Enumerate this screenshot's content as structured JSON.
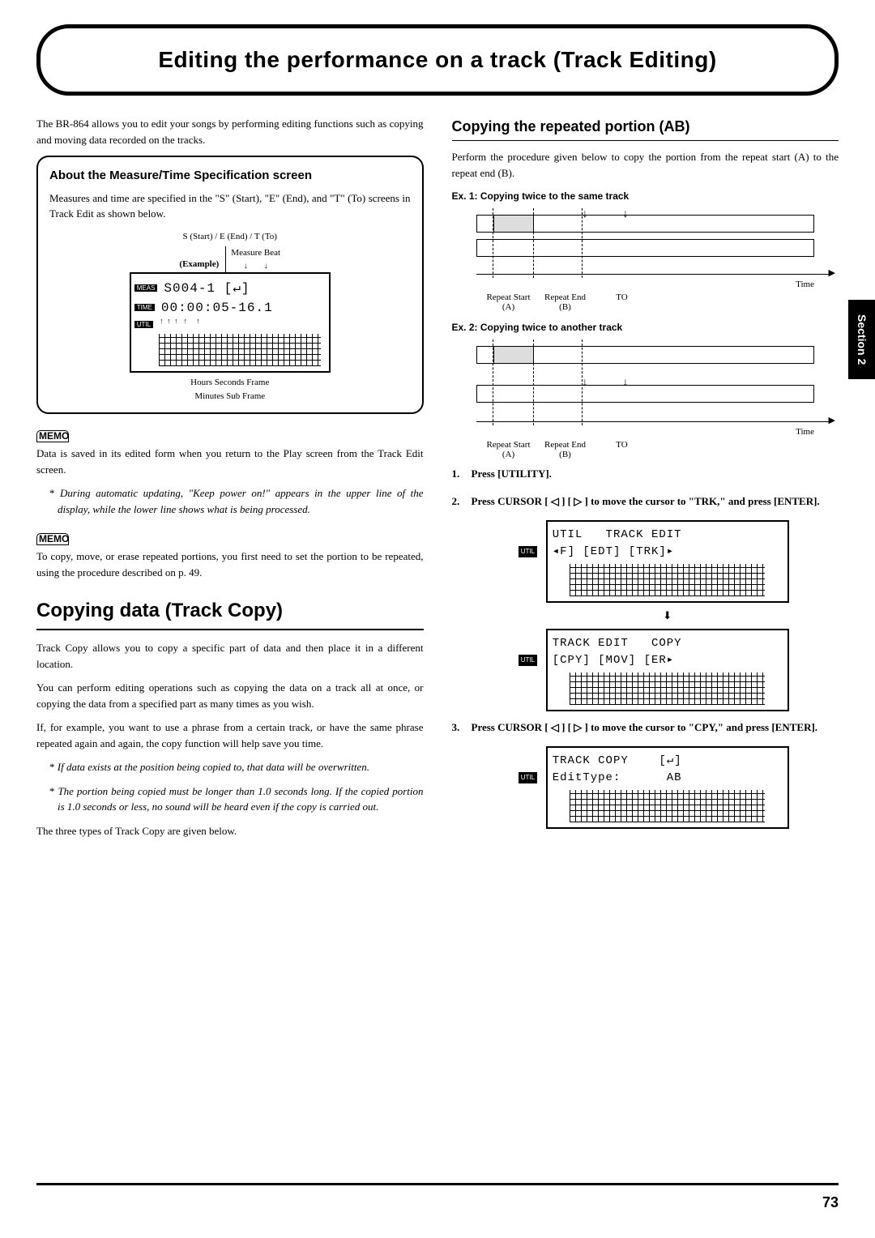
{
  "title": "Editing the performance on a track (Track Editing)",
  "section_tab": "Section 2",
  "page_number": "73",
  "intro": "The BR-864 allows you to edit your songs by performing editing functions such as copying and moving data recorded on the tracks.",
  "about_box": {
    "heading": "About the Measure/Time Specification screen",
    "body": "Measures and time are specified in the \"S\" (Start), \"E\" (End), and \"T\" (To) screens in Track Edit as shown below.",
    "top_label": "S (Start) / E (End)  / T (To)",
    "example_label": "(Example)",
    "col_labels": "Measure   Beat",
    "meas_tag": "MEAS",
    "time_tag": "TIME",
    "util_tag": "UTIL",
    "lcd_line1": "S004-1        [↵]",
    "lcd_line2": "00:00:05-16.1",
    "bottom_labels_1": "Hours       Seconds  Frame",
    "bottom_labels_2": "Minutes                       Sub Frame"
  },
  "memo1_body": "Data is saved in its edited form when you return to the Play screen from the Track Edit screen.",
  "memo1_note": "During automatic updating, \"Keep power on!\" appears in the upper line of the display, while the lower line shows what is being processed.",
  "memo2_body": "To copy, move, or erase repeated portions, you first need to set the portion to be repeated, using the procedure described on p. 49.",
  "h2_copy": "Copying data (Track Copy)",
  "copy_p1": "Track Copy allows you to copy a specific part of data and then place it in a different location.",
  "copy_p2": "You can perform editing operations such as copying the data on a track all at once, or copying the data from a specified part as many times as you wish.",
  "copy_p3": "If, for example, you want to use a phrase from a certain track, or have the same phrase repeated again and again, the copy function will help save you time.",
  "copy_note1": "If data exists at the position being copied to, that data will be overwritten.",
  "copy_note2": "The portion being copied must be longer than 1.0 seconds long. If the copied portion is 1.0 seconds or less, no sound will be heard even if the copy is carried out.",
  "copy_p4": "The three types of Track Copy are given below.",
  "h3_ab": "Copying the repeated portion (AB)",
  "ab_intro": "Perform the procedure given below to copy the portion from the repeat start (A) to the repeat end (B).",
  "ex1_label": "Ex. 1: Copying twice to the same track",
  "ex2_label": "Ex. 2: Copying twice to another track",
  "fig_labels": {
    "repeat_a": "Repeat Start (A)",
    "repeat_b": "Repeat End (B)",
    "to": "TO",
    "time": "Time"
  },
  "steps": {
    "s1": "Press [UTILITY].",
    "s2": "Press CURSOR [ ◁ ] [ ▷ ] to move the cursor to \"TRK,\" and press [ENTER].",
    "s3": "Press CURSOR [ ◁ ] [ ▷ ] to move the cursor to \"CPY,\" and press [ENTER]."
  },
  "lcd1": {
    "line1": "UTIL   TRACK EDIT",
    "line2": "◂F] [EDT] [TRK]▸"
  },
  "lcd2": {
    "line1": "TRACK EDIT   COPY",
    "line2": "[CPY] [MOV] [ER▸"
  },
  "lcd3": {
    "line1": "TRACK COPY    [↵]",
    "line2": "EditType:      AB"
  },
  "memo_label": "MEMO"
}
